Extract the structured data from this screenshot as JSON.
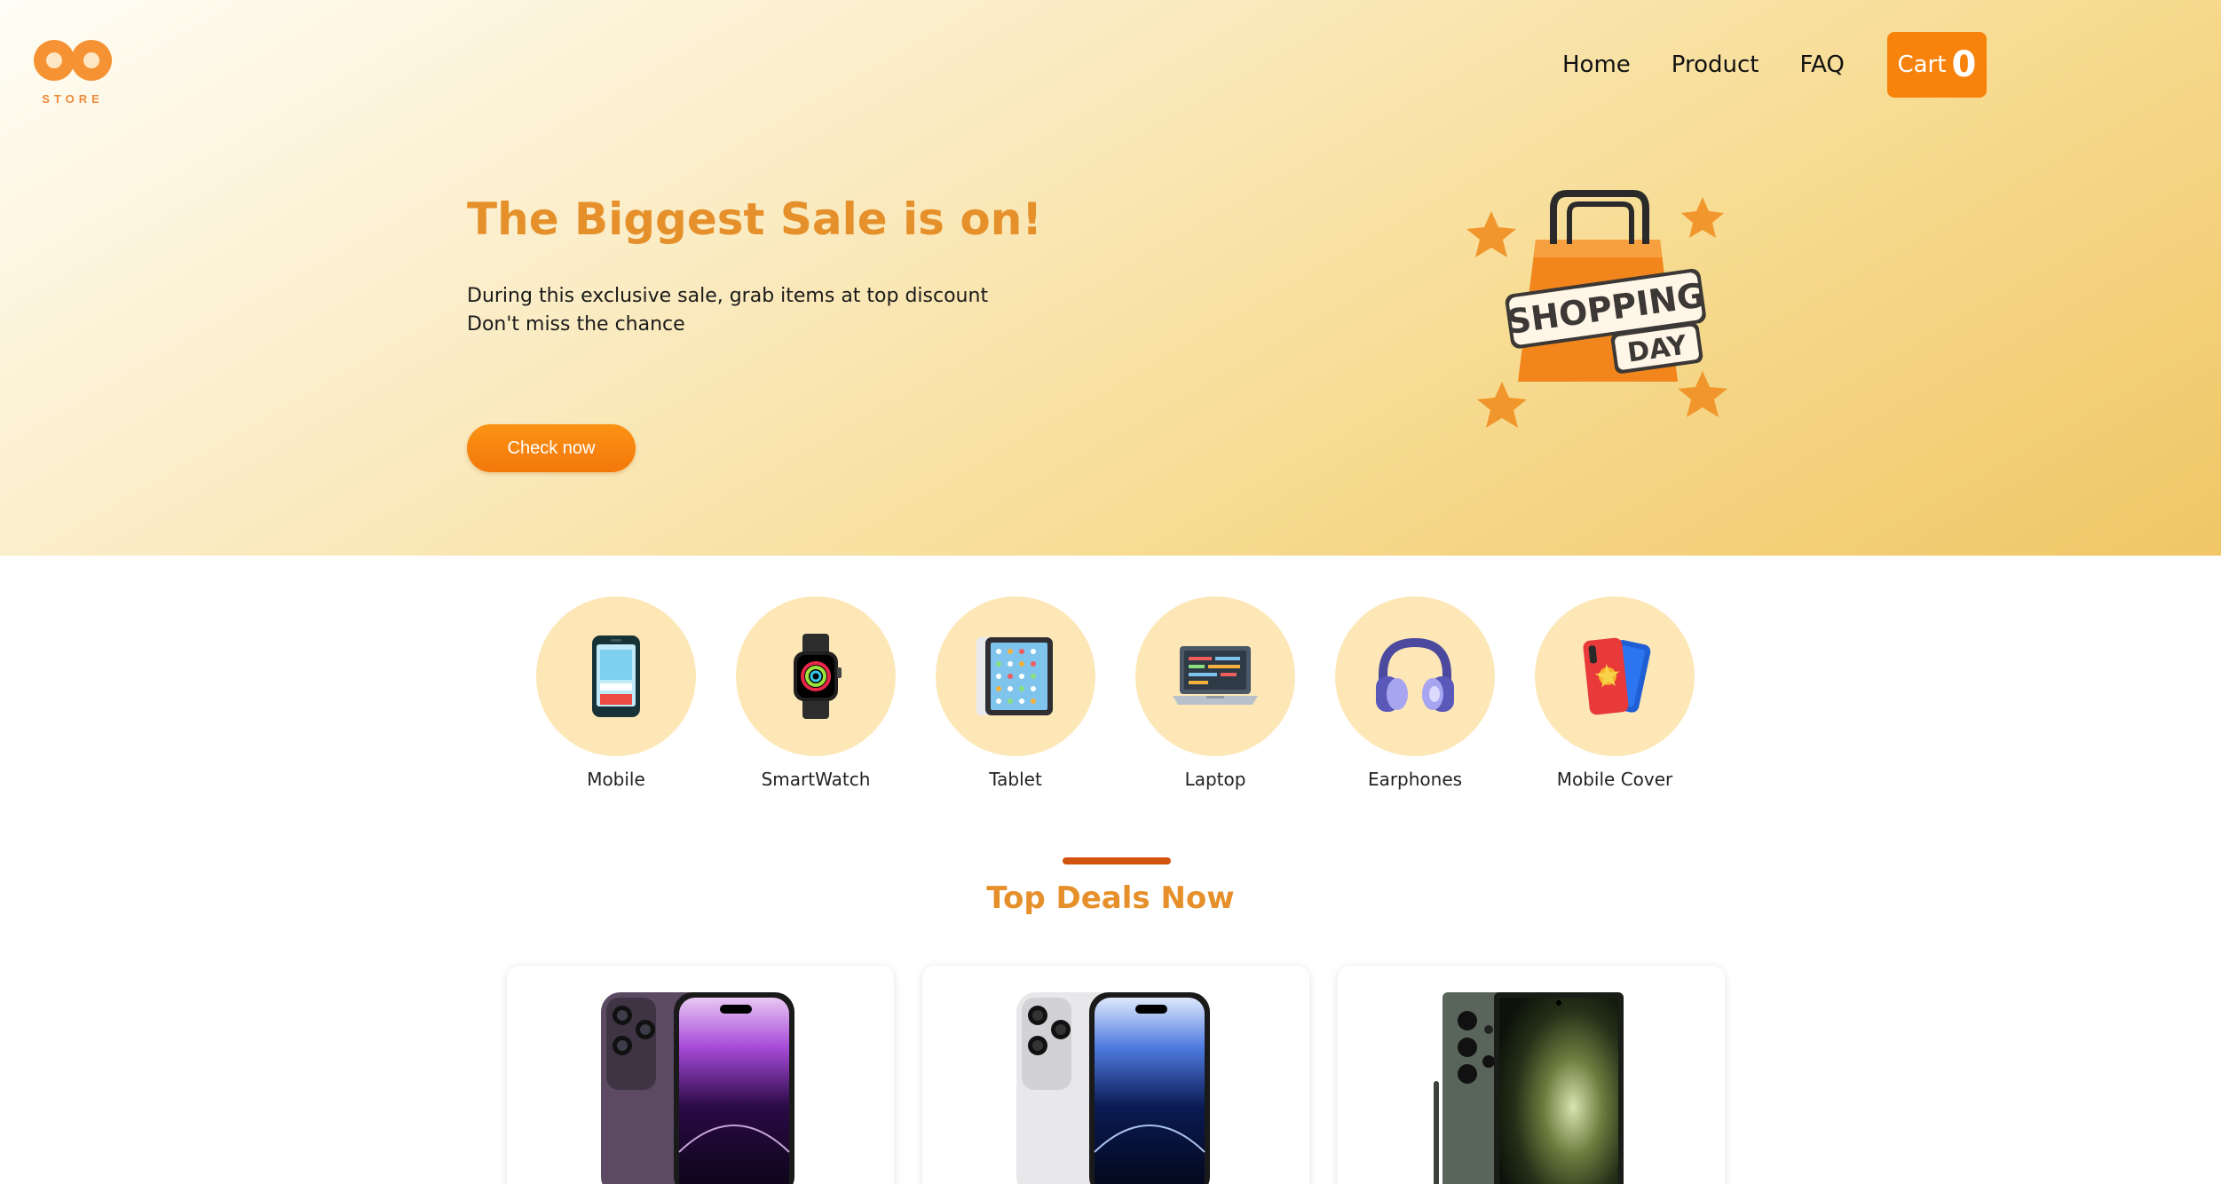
{
  "brand": {
    "logo_text": "STORE"
  },
  "nav": {
    "items": [
      {
        "label": "Home"
      },
      {
        "label": "Product"
      },
      {
        "label": "FAQ"
      }
    ],
    "cart": {
      "label": "Cart",
      "count": "0"
    }
  },
  "hero": {
    "title": "The Biggest Sale is on!",
    "line1": "During this exclusive sale, grab items at top discount",
    "line2": "Don't miss the chance",
    "button_label": "Check now",
    "art_text_1": "SHOPPING",
    "art_text_2": "DAY"
  },
  "categories": [
    {
      "label": "Mobile",
      "icon": "mobile-icon"
    },
    {
      "label": "SmartWatch",
      "icon": "smartwatch-icon"
    },
    {
      "label": "Tablet",
      "icon": "tablet-icon"
    },
    {
      "label": "Laptop",
      "icon": "laptop-icon"
    },
    {
      "label": "Earphones",
      "icon": "headphones-icon"
    },
    {
      "label": "Mobile Cover",
      "icon": "phone-cover-icon"
    }
  ],
  "deals": {
    "title": "Top Deals Now",
    "products": [
      {
        "image": "purple-phone-image"
      },
      {
        "image": "silver-phone-image"
      },
      {
        "image": "green-phone-image"
      }
    ]
  },
  "colors": {
    "accent": "#f7830d",
    "title": "#e5902a",
    "category_bg": "#fde7b6",
    "deals_bar": "#d2540e"
  }
}
